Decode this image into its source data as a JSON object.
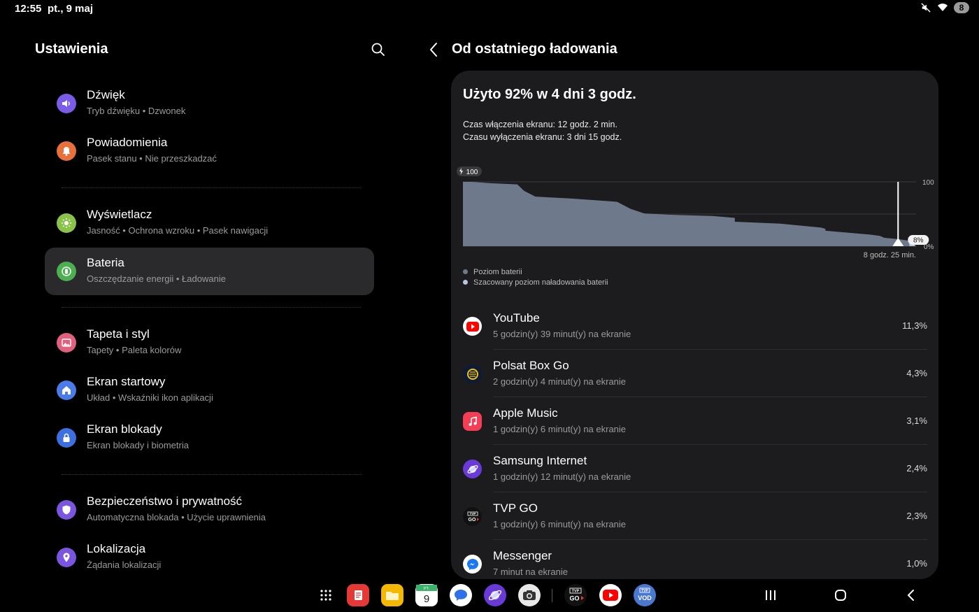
{
  "status_bar": {
    "time": "12:55",
    "date": "pt., 9 maj",
    "notification_count": "8",
    "icons": [
      "mute-icon",
      "wifi-icon"
    ]
  },
  "left": {
    "title": "Ustawienia",
    "items": [
      {
        "title": "Dźwięk",
        "subtitle": "Tryb dźwięku  •  Dzwonek",
        "icon": "sound-icon",
        "color": "#7b5ce6"
      },
      {
        "title": "Powiadomienia",
        "subtitle": "Pasek stanu  •  Nie przeszkadzać",
        "icon": "bell-icon",
        "color": "#e8703a"
      },
      {
        "title": "Wyświetlacz",
        "subtitle": "Jasność  •  Ochrona wzroku  •  Pasek nawigacji",
        "icon": "sun-icon",
        "color": "#8bc34a"
      },
      {
        "title": "Bateria",
        "subtitle": "Oszczędzanie energii  •  Ładowanie",
        "icon": "battery-icon",
        "color": "#4caf50",
        "active": true
      },
      {
        "title": "Tapeta i styl",
        "subtitle": "Tapety  •  Paleta kolorów",
        "icon": "wallpaper-icon",
        "color": "#e0607e"
      },
      {
        "title": "Ekran startowy",
        "subtitle": "Układ  •  Wskaźniki ikon aplikacji",
        "icon": "home-icon",
        "color": "#4a7be8"
      },
      {
        "title": "Ekran blokady",
        "subtitle": "Ekran blokady i biometria",
        "icon": "lock-icon",
        "color": "#3d6fe0"
      },
      {
        "title": "Bezpieczeństwo i prywatność",
        "subtitle": "Automatyczna blokada  •  Użycie uprawnienia",
        "icon": "shield-icon",
        "color": "#7a55e0"
      },
      {
        "title": "Lokalizacja",
        "subtitle": "Żądania lokalizacji",
        "icon": "location-icon",
        "color": "#7a55e0"
      }
    ]
  },
  "right": {
    "title": "Od ostatniego ładowania",
    "usage_heading": "Użyto 92% w 4 dni 3 godz.",
    "screen_on": "Czas włączenia ekranu: 12 godz. 2 min.",
    "screen_off": "Czasu wyłączenia ekranu: 3 dni 15 godz.",
    "legend": [
      "Poziom baterii",
      "Szacowany poziom naładowania baterii"
    ],
    "apps": [
      {
        "name": "YouTube",
        "time": "5 godzin(y) 39 minut(y) na ekranie",
        "percent": "11,3%",
        "icon": "youtube-icon"
      },
      {
        "name": "Polsat Box Go",
        "time": "2 godzin(y) 4 minut(y) na ekranie",
        "percent": "4,3%",
        "icon": "polsat-icon"
      },
      {
        "name": "Apple Music",
        "time": "1 godzin(y) 6 minut(y) na ekranie",
        "percent": "3,1%",
        "icon": "music-icon"
      },
      {
        "name": "Samsung Internet",
        "time": "1 godzin(y) 12 minut(y) na ekranie",
        "percent": "2,4%",
        "icon": "internet-icon"
      },
      {
        "name": "TVP GO",
        "time": "1 godzin(y) 6 minut(y) na ekranie",
        "percent": "2,3%",
        "icon": "tvpgo-icon"
      },
      {
        "name": "Messenger",
        "time": "7 minut na ekranie",
        "percent": "1,0%",
        "icon": "messenger-icon"
      }
    ]
  },
  "chart_data": {
    "type": "area",
    "title": "",
    "ylim": [
      0,
      100
    ],
    "y_ticks": [
      "100",
      "0%"
    ],
    "start_label": "100",
    "current_label": "8%",
    "remaining_label": "8 godz. 25 min.",
    "series": [
      {
        "name": "Poziom baterii",
        "color": "#6e7a8c",
        "x": [
          0,
          0.02,
          0.06,
          0.12,
          0.135,
          0.16,
          0.24,
          0.3,
          0.34,
          0.37,
          0.4,
          0.45,
          0.55,
          0.6,
          0.6,
          0.7,
          0.79,
          0.8,
          0.8,
          0.9,
          0.92,
          0.93,
          0.96,
          0.98,
          0.985
        ],
        "values": [
          100,
          100,
          98,
          96,
          86,
          77,
          74,
          71,
          69,
          58,
          51,
          49,
          47,
          44,
          38,
          35,
          29,
          27,
          24,
          18,
          16,
          13,
          11,
          9,
          8
        ]
      },
      {
        "name": "Szacowany poziom naładowania baterii",
        "color": "#b8c6de",
        "x": [
          0.985,
          1.0
        ],
        "values": [
          8,
          0
        ]
      }
    ]
  },
  "dock": {
    "apps": [
      "app-drawer-icon",
      "notes-icon",
      "files-icon",
      "calendar-icon",
      "messages-icon",
      "internet-icon",
      "camera-icon",
      "tvpgo-icon",
      "youtube-icon",
      "tvpvod-icon"
    ],
    "calendar_label": "PT.",
    "calendar_day": "9",
    "tvp_go_label": "TVP GO",
    "tvp_vod_label": "VOD",
    "nav": [
      "recents-icon",
      "home-icon",
      "back-icon"
    ]
  }
}
